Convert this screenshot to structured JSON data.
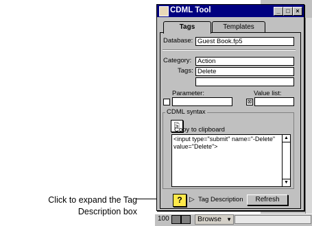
{
  "callout": {
    "line1": "Click to expand the Tag",
    "line2": "Description box"
  },
  "window": {
    "title": "CDML Tool",
    "min_glyph": "_",
    "max_glyph": "□",
    "close_glyph": "×"
  },
  "tabs": [
    {
      "label": "Tags"
    },
    {
      "label": "Templates"
    }
  ],
  "form": {
    "database_label": "Database:",
    "database_value": "Guest Book.fp5",
    "category_label": "Category:",
    "category_value": "Action",
    "tags_label": "Tags:",
    "tags_value": "Delete",
    "extra_value": "",
    "parameter_label": "Parameter:",
    "valuelist_label": "Value list:"
  },
  "cdml": {
    "group_label": "CDML syntax",
    "copy_label": "Copy  to clipboard",
    "syntax_text": "<input type=\"submit\" name=\"-Delete\" value=\"Delete\">"
  },
  "footer": {
    "help_glyph": "?",
    "expand_glyph": "▷",
    "tag_description_label": "Tag Description",
    "refresh_label": "Refresh"
  },
  "statusbar": {
    "zoom": "100",
    "mode": "Browse"
  }
}
